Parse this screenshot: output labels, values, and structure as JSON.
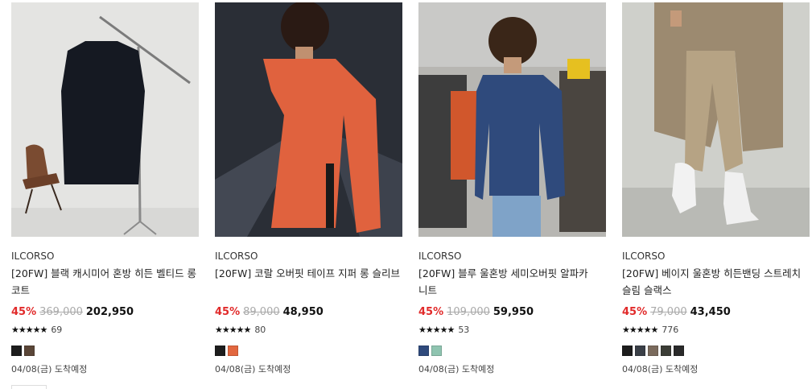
{
  "products": [
    {
      "brand": "ILCORSO",
      "title": "[20FW] 블랙 캐시미어 혼방 히든 벨티드 롱 코트",
      "discount": "45%",
      "original_price": "369,000",
      "sale_price": "202,950",
      "stars": "★★★★★",
      "rating_count": "69",
      "colors": [
        "#1d1d1d",
        "#5a4638"
      ],
      "delivery": "04/08(금) 도착예정"
    },
    {
      "brand": "ILCORSO",
      "title": "[20FW] 코랄 오버핏 테이프 지퍼 롱 슬리브",
      "discount": "45%",
      "original_price": "89,000",
      "sale_price": "48,950",
      "stars": "★★★★★",
      "rating_count": "80",
      "colors": [
        "#1d1d1d",
        "#e2673f"
      ],
      "delivery": "04/08(금) 도착예정"
    },
    {
      "brand": "ILCORSO",
      "title": "[20FW] 블루 울혼방 세미오버핏 알파카 니트",
      "discount": "45%",
      "original_price": "109,000",
      "sale_price": "59,950",
      "stars": "★★★★★",
      "rating_count": "53",
      "colors": [
        "#2f4a7c",
        "#8fc4b0"
      ],
      "delivery": "04/08(금) 도착예정"
    },
    {
      "brand": "ILCORSO",
      "title": "[20FW] 베이지 울혼방 히든밴딩 스트레치 슬림 슬랙스",
      "discount": "45%",
      "original_price": "79,000",
      "sale_price": "43,450",
      "stars": "★★★★★",
      "rating_count": "776",
      "colors": [
        "#1d1d1d",
        "#3a3f47",
        "#7a6a5c",
        "#3b3d36",
        "#2a2a2a"
      ],
      "delivery": "04/08(금) 도착예정"
    }
  ]
}
